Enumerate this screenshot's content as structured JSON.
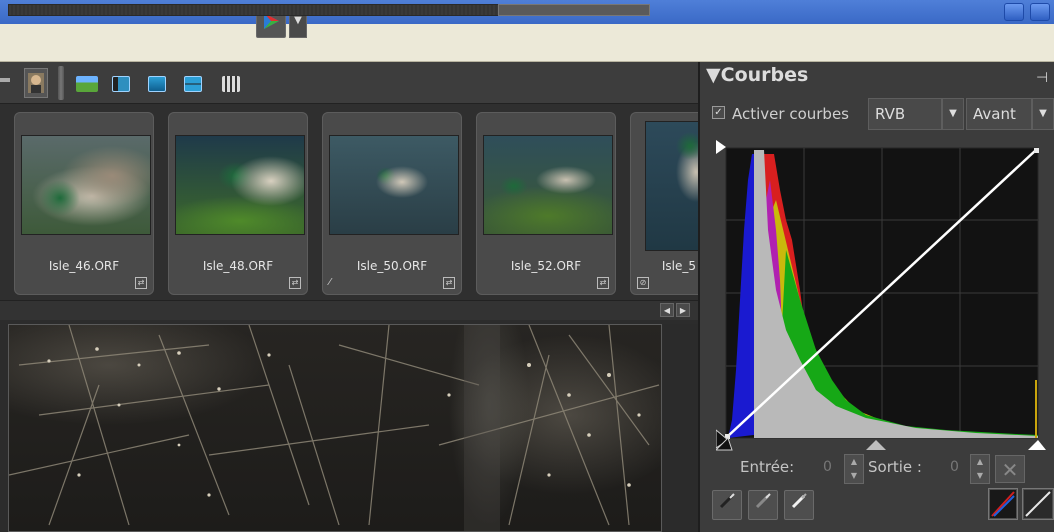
{
  "thumbnails": [
    {
      "label": "Isle_46.ORF"
    },
    {
      "label": "Isle_48.ORF"
    },
    {
      "label": "Isle_50.ORF"
    },
    {
      "label": "Isle_52.ORF"
    },
    {
      "label": "Isle_5"
    }
  ],
  "curves_panel": {
    "title": "Courbes",
    "collapse_glyph": "▼",
    "activer_label": "Activer courbes",
    "activer_checked": true,
    "channel_value": "RVB",
    "view_value": "Avant",
    "entree_label": "Entrée:",
    "entree_value": "0",
    "sortie_label": "Sortie :",
    "sortie_value": "0"
  },
  "icons": {
    "film-filter": "avatar-icon",
    "reset": "close-x-icon",
    "pipettes": [
      "black-point-eyedropper-icon",
      "gray-point-eyedropper-icon",
      "white-point-eyedropper-icon"
    ]
  },
  "colors": {
    "title_bar": "#3a69c6",
    "panel_bg": "#3c3c3c",
    "histogram_gray": "#b9b9b9",
    "histogram_red": "#d81f1f",
    "histogram_yellow": "#c9b90c",
    "histogram_green": "#16a816",
    "histogram_blue": "#1a1ad0",
    "curve_line": "#ffffff"
  }
}
